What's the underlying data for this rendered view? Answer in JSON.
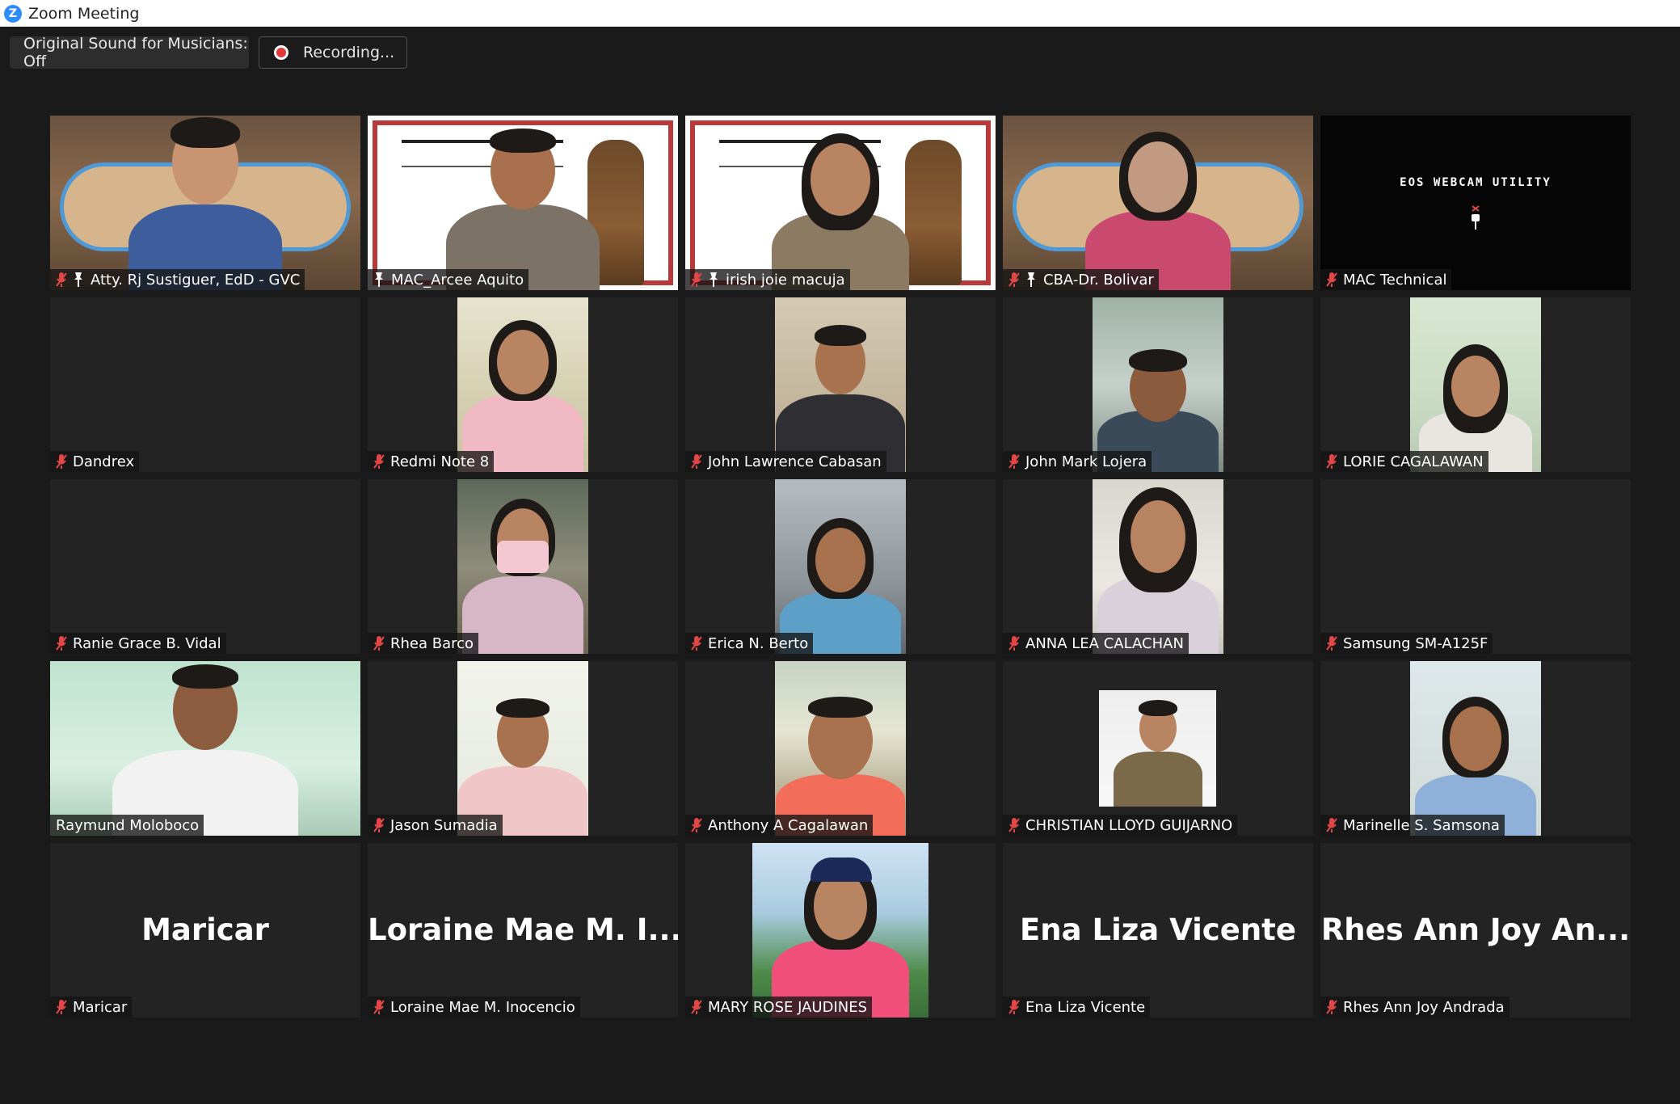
{
  "window": {
    "title": "Zoom Meeting",
    "logo": "zoom-logo-icon"
  },
  "toolbar": {
    "sound_label": "Original Sound for Musicians: Off",
    "recording_label": "Recording..."
  },
  "colors": {
    "active_speaker_border": "#f3e66c",
    "muted_icon": "#e24646",
    "background": "#1a1a1a",
    "tile_background": "#232323"
  },
  "participants": [
    {
      "name": "Atty. Rj Sustiguer, EdD - GVC",
      "muted": true,
      "pinned": true
    },
    {
      "name": "MAC_Arcee Aquito",
      "muted": false,
      "pinned": true,
      "active_speaker": true
    },
    {
      "name": "irish joie macuja",
      "muted": true,
      "pinned": true
    },
    {
      "name": "CBA-Dr. Bolivar",
      "muted": true,
      "pinned": true
    },
    {
      "name": "MAC Technical",
      "muted": true,
      "screen_text": "EOS WEBCAM UTILITY"
    },
    {
      "name": "Dandrex",
      "muted": true
    },
    {
      "name": "Redmi Note 8",
      "muted": true
    },
    {
      "name": "John Lawrence Cabasan",
      "muted": true
    },
    {
      "name": "John Mark Lojera",
      "muted": true
    },
    {
      "name": "LORIE CAGALAWAN",
      "muted": true
    },
    {
      "name": "Ranie Grace B. Vidal",
      "muted": true
    },
    {
      "name": "Rhea Barco",
      "muted": true
    },
    {
      "name": "Erica N. Berto",
      "muted": true
    },
    {
      "name": "ANNA LEA CALACHAN",
      "muted": true
    },
    {
      "name": "Samsung SM-A125F",
      "muted": true
    },
    {
      "name": "Raymund Moloboco",
      "muted": false
    },
    {
      "name": "Jason Sumadia",
      "muted": true
    },
    {
      "name": "Anthony A Cagalawan",
      "muted": true
    },
    {
      "name": "CHRISTIAN LLOYD GUIJARNO",
      "muted": true
    },
    {
      "name": "Marinelle S. Samsona",
      "muted": true
    },
    {
      "name": "Maricar",
      "muted": true,
      "display_name": "Maricar"
    },
    {
      "name": "Loraine Mae M. Inocencio",
      "muted": true,
      "display_name": "Loraine Mae M. I..."
    },
    {
      "name": "MARY ROSE JAUDINES",
      "muted": true
    },
    {
      "name": "Ena Liza Vicente",
      "muted": true,
      "display_name": "Ena Liza Vicente"
    },
    {
      "name": "Rhes Ann Joy Andrada",
      "muted": true,
      "display_name": "Rhes Ann Joy An..."
    }
  ]
}
